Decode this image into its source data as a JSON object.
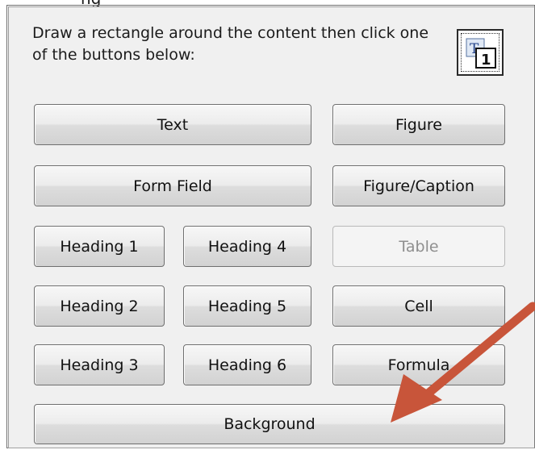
{
  "dialog": {
    "title_fragment": "ng",
    "instructions": "Draw a rectangle around the content then click one of the buttons below:"
  },
  "buttons": {
    "text": "Text",
    "figure": "Figure",
    "form_field": "Form Field",
    "figure_caption": "Figure/Caption",
    "heading1": "Heading 1",
    "heading4": "Heading 4",
    "table": "Table",
    "heading2": "Heading 2",
    "heading5": "Heading 5",
    "cell": "Cell",
    "heading3": "Heading 3",
    "heading6": "Heading 6",
    "formula": "Formula",
    "background": "Background"
  },
  "states": {
    "table_enabled": false
  },
  "colors": {
    "annotation_arrow": "#c8553a",
    "panel_bg": "#f0f0f0"
  },
  "icons": {
    "corner": "text-to-number-icon"
  }
}
